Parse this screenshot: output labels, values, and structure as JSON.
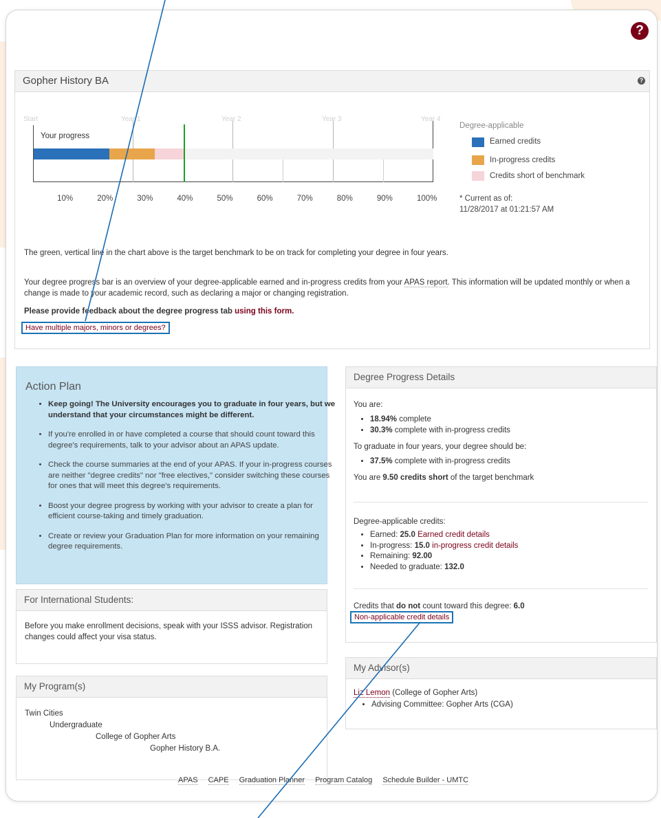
{
  "header": {
    "help_icon": "?"
  },
  "history_panel": {
    "title": "Gopher History BA",
    "help_icon": "?",
    "chart": {
      "year_labels": [
        "Start",
        "Year 1",
        "Year 2",
        "Year 3",
        "Year 4"
      ],
      "progress_label": "Your progress",
      "pct_ticks": [
        "10%",
        "20%",
        "30%",
        "40%",
        "50%",
        "60%",
        "70%",
        "80%",
        "90%",
        "100%"
      ],
      "legend_title": "Degree-applicable",
      "legend": [
        {
          "label": "Earned credits",
          "color": "#2b71b9"
        },
        {
          "label": "In-progress credits",
          "color": "#e8a54b"
        },
        {
          "label": "Credits short of benchmark",
          "color": "#f6d4d9"
        }
      ],
      "current_as_of_label": "* Current as of:",
      "current_as_of_value": "11/28/2017 at 01:21:57 AM",
      "earned_pct": 18.94,
      "inprogress_pct": 30.3,
      "benchmark_pct": 37.5
    },
    "benchmark_note": "The green, vertical line in the chart above is the target benchmark to be on track for completing your degree in four years.",
    "overview_1": "Your degree progress bar is an overview of your degree-applicable earned and in-progress credits from your ",
    "overview_link": "APAS report",
    "overview_2": ". This information will be updated monthly or when a",
    "overview_line2": "change is made to your academic record, such as declaring a major or changing registration.",
    "feedback_text": "Please provide feedback about the degree progress tab ",
    "feedback_link": "using this form.",
    "multi_link": "Have multiple majors, minors or degrees?"
  },
  "action_plan": {
    "title": "Action Plan",
    "items": [
      "Keep going! The University encourages you to graduate in four years, but we understand that your circumstances might be different.",
      "If you're enrolled in or have completed a course that should count toward this degree's requirements, talk to your advisor about an APAS update.",
      "Check the course summaries at the end of your APAS. If your in-progress courses are neither \"degree credits\" nor \"free electives,\" consider switching these courses for ones that will meet this degree's requirements.",
      "Boost your degree progress by working with your advisor to create a plan for efficient course-taking and timely graduation.",
      "Create or review your Graduation Plan for more information on your remaining degree requirements."
    ]
  },
  "international": {
    "title": "For International Students:",
    "body": "Before you make enrollment decisions, speak with your ISSS advisor.  Registration changes could affect your visa status."
  },
  "programs": {
    "title": "My Program(s)",
    "campus": "Twin Cities",
    "level": "Undergraduate",
    "college": "College of Gopher Arts",
    "program": "Gopher History B.A."
  },
  "details": {
    "title": "Degree Progress Details",
    "you_are": "You are:",
    "complete_val": "18.94%",
    "complete_txt": " complete",
    "inprog_val": "30.3%",
    "inprog_txt": " complete with in-progress credits",
    "to_graduate": "To graduate in four years, your degree should be:",
    "target_val": "37.5%",
    "target_txt": " complete with in-progress credits",
    "short_pre": "You are ",
    "short_val": "9.50 credits short",
    "short_post": " of the target benchmark",
    "applicable_title": "Degree-applicable credits:",
    "earned_label": "Earned: ",
    "earned_val": "25.0",
    "earned_link": "Earned credit details",
    "inprogress_label": "In-progress: ",
    "inprogress_val": "15.0",
    "inprogress_link": "in-progress credit details",
    "remaining_label": "Remaining: ",
    "remaining_val": "92.00",
    "needed_label": "Needed to graduate: ",
    "needed_val": "132.0",
    "nonapp_pre": "Credits that ",
    "nonapp_bold": "do not",
    "nonapp_post": " count toward this degree: ",
    "nonapp_val": "6.0",
    "nonapp_link": "Non-applicable credit details"
  },
  "advisors": {
    "title": "My Advisor(s)",
    "name": "Liz Lemon",
    "college": " (College of Gopher Arts)",
    "committee": "Advising Committee: Gopher Arts (CGA)"
  },
  "footer": {
    "links": [
      "APAS",
      "CAPE",
      "Graduation Planner",
      "Program Catalog",
      "Schedule Builder - UMTC"
    ]
  }
}
